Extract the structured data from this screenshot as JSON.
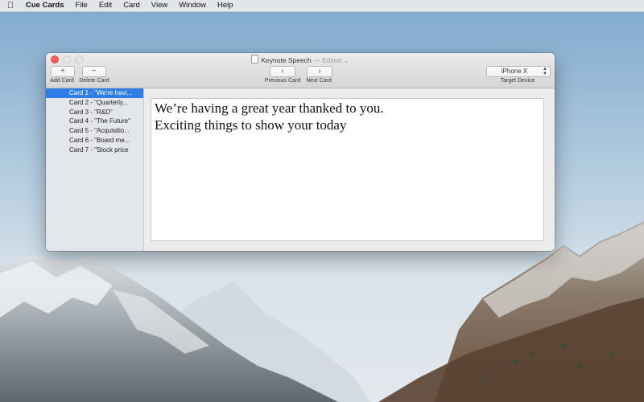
{
  "menubar": {
    "apple_icon": "apple-icon",
    "items": [
      "Cue Cards",
      "File",
      "Edit",
      "Card",
      "View",
      "Window",
      "Help"
    ]
  },
  "window": {
    "title": "Keynote Speech",
    "edited": "— Edited",
    "toolbar": {
      "add_icon": "+",
      "add_label": "Add Card",
      "delete_icon": "−",
      "delete_label": "Delete Card",
      "prev_icon": "‹",
      "prev_label": "Previous Card",
      "next_icon": "›",
      "next_label": "Next Card",
      "device_value": "iPhone X",
      "device_label": "Target Device"
    },
    "cards": [
      "Card 1 - \"We're havi...",
      "Card 2 - \"Quarterly...",
      "Card 3 - \"R&D\"",
      "Card 4 - \"The Future\"",
      "Card 5 - \"Acquisitio...",
      "Card 6 - \"Board me...",
      "Card 7 - \"Stock price"
    ],
    "selected_card": 0,
    "editor_lines": [
      "We’re having a great year thanked to you.",
      "Exciting things to show your today"
    ]
  },
  "colors": {
    "selection": "#2f7ee8",
    "close": "#fc5b57"
  }
}
